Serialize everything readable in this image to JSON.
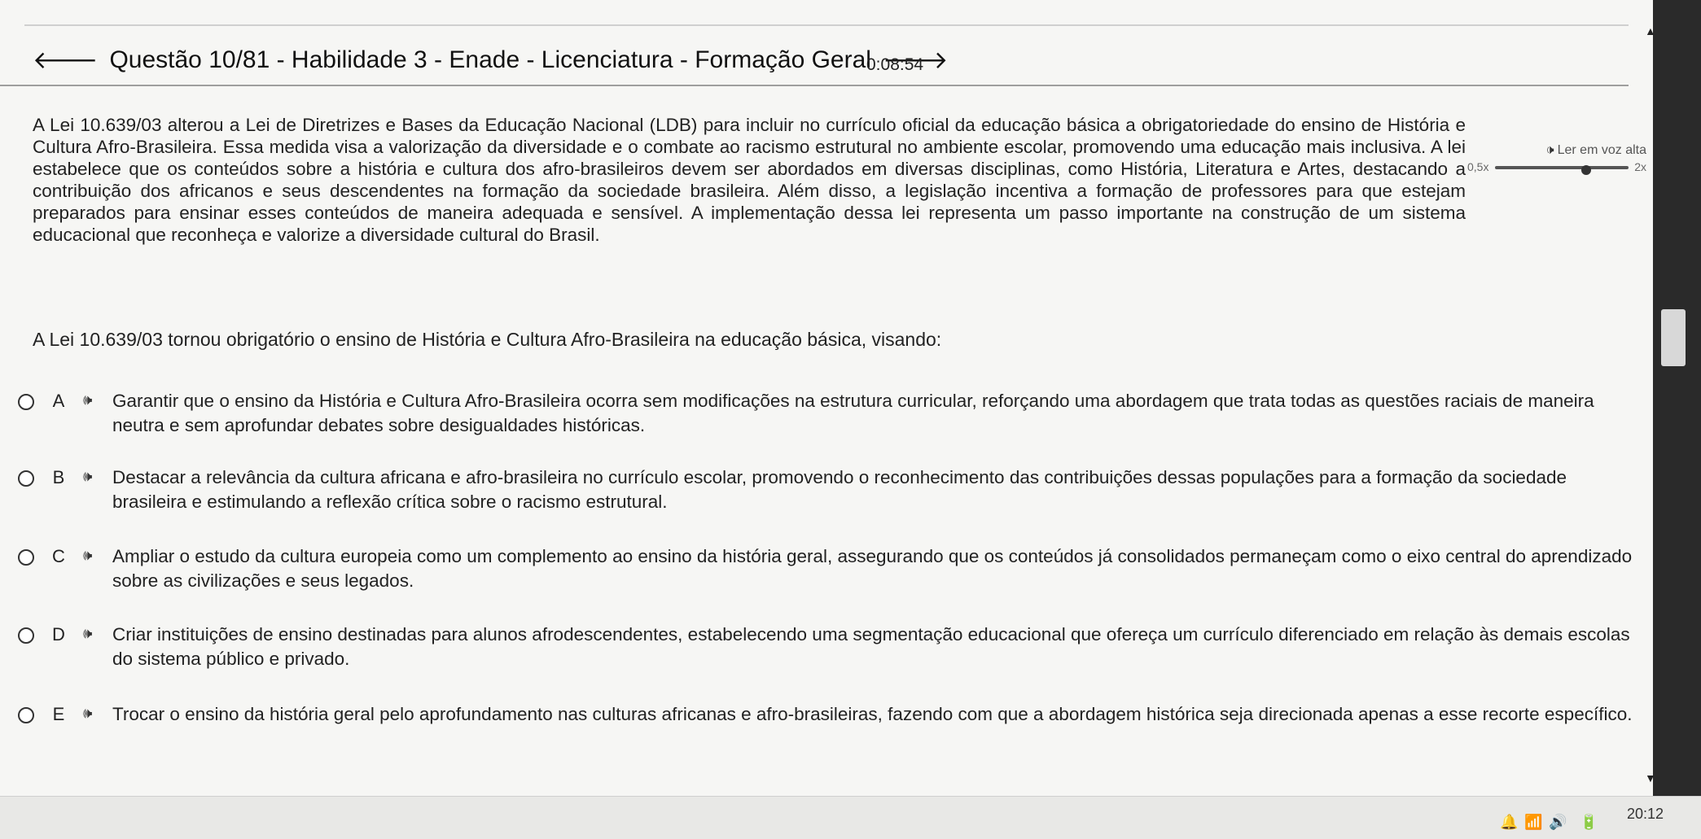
{
  "header": {
    "title": "Questão 10/81 - Habilidade 3 - Enade - Licenciatura - Formação Geral",
    "timer": "0:08:54",
    "back_icon": "arrow-left-icon",
    "next_icon": "arrow-right-icon"
  },
  "tts": {
    "label": "Ler em voz alta",
    "speed_min": "0,5x",
    "speed_max": "2x",
    "speed_level": 0.68
  },
  "passage": "A Lei 10.639/03 alterou a Lei de Diretrizes e Bases da Educação Nacional (LDB) para incluir no currículo oficial da educação básica a obrigatoriedade do ensino de História e Cultura Afro-Brasileira. Essa medida visa a valorização da diversidade e o combate ao racismo estrutural no ambiente escolar, promovendo uma educação mais inclusiva. A lei estabelece que os conteúdos sobre a história e cultura dos afro-brasileiros devem ser abordados em diversas disciplinas, como História, Literatura e Artes, destacando a contribuição dos africanos e seus descendentes na formação da sociedade brasileira. Além disso, a legislação incentiva a formação de professores para que estejam preparados para ensinar esses conteúdos de maneira adequada e sensível. A implementação dessa lei representa um passo importante na construção de um sistema educacional que reconheça e valorize a diversidade cultural do Brasil.",
  "question": "A Lei 10.639/03 tornou obrigatório o ensino de História e Cultura Afro-Brasileira na educação básica, visando:",
  "options": [
    {
      "letter": "A",
      "text": "Garantir que o ensino da História e Cultura Afro-Brasileira ocorra sem modificações na estrutura curricular, reforçando uma abordagem que trata todas as questões raciais de maneira neutra e sem aprofundar debates sobre desigualdades históricas."
    },
    {
      "letter": "B",
      "text": "Destacar a relevância da cultura africana e afro-brasileira no currículo escolar, promovendo o reconhecimento das contribuições dessas populações para a formação da sociedade brasileira e estimulando a reflexão crítica sobre o racismo estrutural."
    },
    {
      "letter": "C",
      "text": "Ampliar o estudo da cultura europeia como um complemento ao ensino da história geral, assegurando que os conteúdos já consolidados permaneçam como o eixo central do aprendizado sobre as civilizações e seus legados."
    },
    {
      "letter": "D",
      "text": "Criar instituições de ensino destinadas para alunos afrodescendentes, estabelecendo uma segmentação educacional que ofereça um currículo diferenciado em relação às demais escolas do sistema público e privado."
    },
    {
      "letter": "E",
      "text": "Trocar o ensino da história geral pelo aprofundamento nas culturas africanas e afro-brasileiras, fazendo com que a abordagem histórica seja direcionada apenas a esse recorte específico."
    }
  ],
  "system": {
    "clock": "20:12"
  }
}
